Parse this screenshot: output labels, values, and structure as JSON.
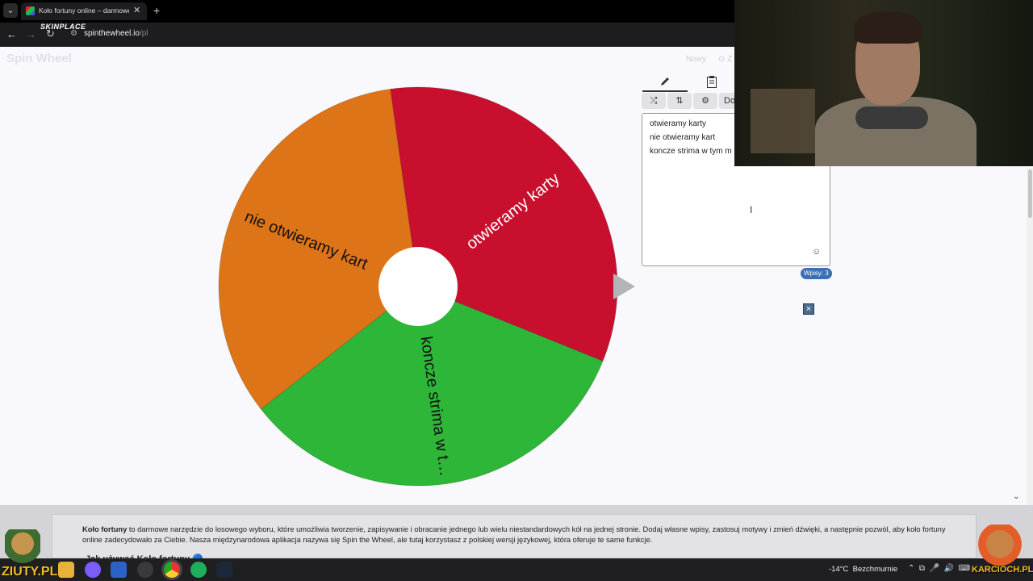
{
  "browser": {
    "tab_title": "Koło fortuny online – darmowe",
    "url_host": "spinthewheel.io",
    "url_path": "/pl",
    "extension_label": "SKINPLACE"
  },
  "site": {
    "logo": "Spin Wheel",
    "nav_new": "Nowy",
    "nav_save": "⊙ Z"
  },
  "wheel": {
    "segments": [
      {
        "label": "otwieramy karty",
        "color": "#c8102e"
      },
      {
        "label": "nie otwieramy kart",
        "color": "#dd7417"
      },
      {
        "label": "koncze strima w t…",
        "color": "#2eb638"
      }
    ],
    "pointer_color": "#b4b4b8"
  },
  "panel": {
    "tab_edit_icon": "pencil-icon",
    "tab_clipboard_icon": "clipboard-icon",
    "shuffle_icon": "⤮",
    "sort_icon": "⇅",
    "settings_icon": "⚙",
    "partial_button": "Do",
    "entries": [
      "otwieramy karty",
      "nie otwieramy kart",
      "koncze strima w tym m"
    ],
    "emoji_icon": "☺",
    "count_label": "Wpisy: 3",
    "close_label": "×"
  },
  "info": {
    "bold_lead": "Koło fortuny",
    "text": " to darmowe narzędzie do losowego wyboru, które umożliwia tworzenie, zapisywanie i obracanie jednego lub wielu niestandardowych kół na jednej stronie. Dodaj własne wpisy, zastosuj motywy i zmień dźwięki, a następnie pozwól, aby koło fortuny online zadecydowało za Ciebie. Nasza międzynarodowa aplikacja nazywa się Spin the Wheel, ale tutaj korzystasz z polskiej wersji językowej, która oferuje te same funkcje.",
    "heading": "Jak używać Koło fortuny 🔵"
  },
  "overlay": {
    "brand_left": "ZIUTY.PL",
    "brand_right": "KARCIOCH.PL"
  },
  "taskbar": {
    "weather_temp": "-14°C",
    "weather_desc": "Bezchmurnie",
    "icons": [
      "file-explorer-icon",
      "messenger-icon",
      "calendar-icon",
      "obs-icon",
      "chrome-icon",
      "app-green-icon",
      "steam-icon"
    ]
  }
}
